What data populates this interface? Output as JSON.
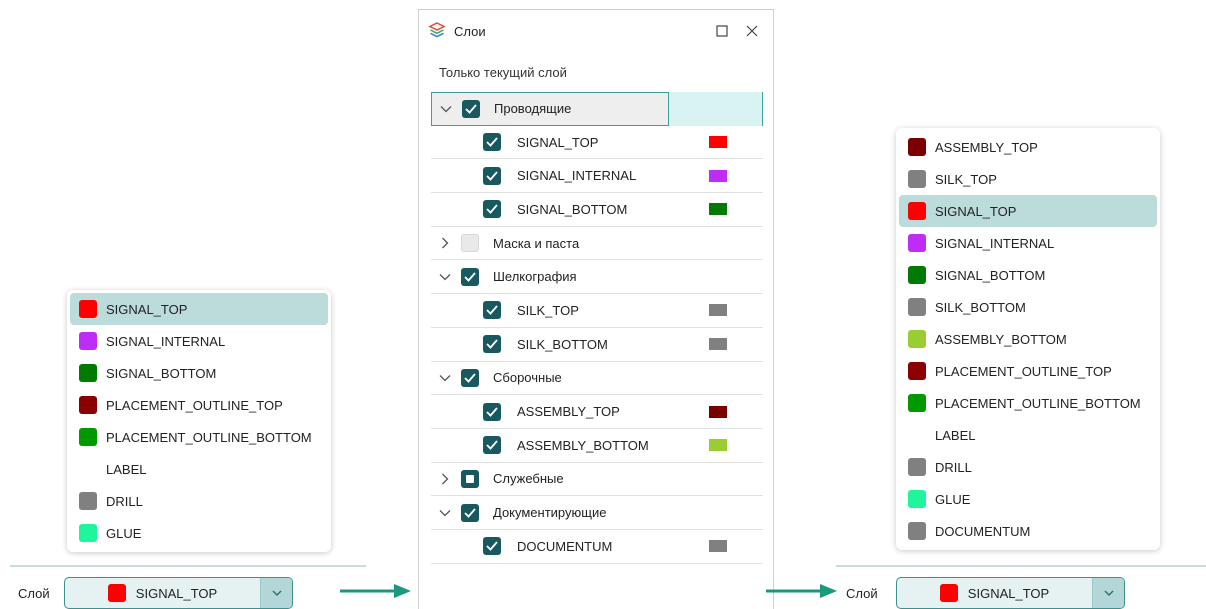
{
  "colors": {
    "accent": "#17595e",
    "selected_row": "#bcdcdc",
    "select_bg": "#e6f1f1",
    "arrow": "#1a9a7c"
  },
  "left_dropdown": {
    "items": [
      {
        "label": "SIGNAL_TOP",
        "color": "#ff0000",
        "selected": true
      },
      {
        "label": "SIGNAL_INTERNAL",
        "color": "#bf2cf5",
        "selected": false
      },
      {
        "label": "SIGNAL_BOTTOM",
        "color": "#007a00",
        "selected": false
      },
      {
        "label": "PLACEMENT_OUTLINE_TOP",
        "color": "#8b0000",
        "selected": false
      },
      {
        "label": "PLACEMENT_OUTLINE_BOTTOM",
        "color": "#009900",
        "selected": false
      },
      {
        "label": "LABEL",
        "color": "",
        "selected": false
      },
      {
        "label": "DRILL",
        "color": "#808080",
        "selected": false
      },
      {
        "label": "GLUE",
        "color": "#1ff59a",
        "selected": false
      }
    ]
  },
  "left_selector": {
    "label": "Слой",
    "value": "SIGNAL_TOP",
    "value_color": "#ff0000"
  },
  "layers_panel": {
    "title": "Слои",
    "only_current_label": "Только текущий слой",
    "rows": [
      {
        "type": "group",
        "label": "Проводящие",
        "expanded": true,
        "check": "checked",
        "active": true
      },
      {
        "type": "layer",
        "label": "SIGNAL_TOP",
        "check": "checked",
        "color": "#ff0000"
      },
      {
        "type": "layer",
        "label": "SIGNAL_INTERNAL",
        "check": "checked",
        "color": "#bf2cf5"
      },
      {
        "type": "layer",
        "label": "SIGNAL_BOTTOM",
        "check": "checked",
        "color": "#007a00"
      },
      {
        "type": "group",
        "label": "Маска и паста",
        "expanded": false,
        "check": "empty"
      },
      {
        "type": "group",
        "label": "Шелкография",
        "expanded": true,
        "check": "checked"
      },
      {
        "type": "layer",
        "label": "SILK_TOP",
        "check": "checked",
        "color": "#808080"
      },
      {
        "type": "layer",
        "label": "SILK_BOTTOM",
        "check": "checked",
        "color": "#808080"
      },
      {
        "type": "group",
        "label": "Сборочные",
        "expanded": true,
        "check": "checked"
      },
      {
        "type": "layer",
        "label": "ASSEMBLY_TOP",
        "check": "checked",
        "color": "#7a0000"
      },
      {
        "type": "layer",
        "label": "ASSEMBLY_BOTTOM",
        "check": "checked",
        "color": "#9acd32"
      },
      {
        "type": "group",
        "label": "Служебные",
        "expanded": false,
        "check": "partial"
      },
      {
        "type": "group",
        "label": "Документирующие",
        "expanded": true,
        "check": "checked"
      },
      {
        "type": "layer",
        "label": "DOCUMENTUM",
        "check": "checked",
        "color": "#808080"
      }
    ]
  },
  "right_dropdown": {
    "items": [
      {
        "label": "ASSEMBLY_TOP",
        "color": "#7a0000",
        "selected": false
      },
      {
        "label": "SILK_TOP",
        "color": "#808080",
        "selected": false
      },
      {
        "label": "SIGNAL_TOP",
        "color": "#ff0000",
        "selected": true
      },
      {
        "label": "SIGNAL_INTERNAL",
        "color": "#bf2cf5",
        "selected": false
      },
      {
        "label": "SIGNAL_BOTTOM",
        "color": "#007a00",
        "selected": false
      },
      {
        "label": "SILK_BOTTOM",
        "color": "#808080",
        "selected": false
      },
      {
        "label": "ASSEMBLY_BOTTOM",
        "color": "#9acd32",
        "selected": false
      },
      {
        "label": "PLACEMENT_OUTLINE_TOP",
        "color": "#8b0000",
        "selected": false
      },
      {
        "label": "PLACEMENT_OUTLINE_BOTTOM",
        "color": "#009900",
        "selected": false
      },
      {
        "label": "LABEL",
        "color": "",
        "selected": false
      },
      {
        "label": "DRILL",
        "color": "#808080",
        "selected": false
      },
      {
        "label": "GLUE",
        "color": "#1ff59a",
        "selected": false
      },
      {
        "label": "DOCUMENTUM",
        "color": "#808080",
        "selected": false
      }
    ]
  },
  "right_selector": {
    "label": "Слой",
    "value": "SIGNAL_TOP",
    "value_color": "#ff0000"
  }
}
